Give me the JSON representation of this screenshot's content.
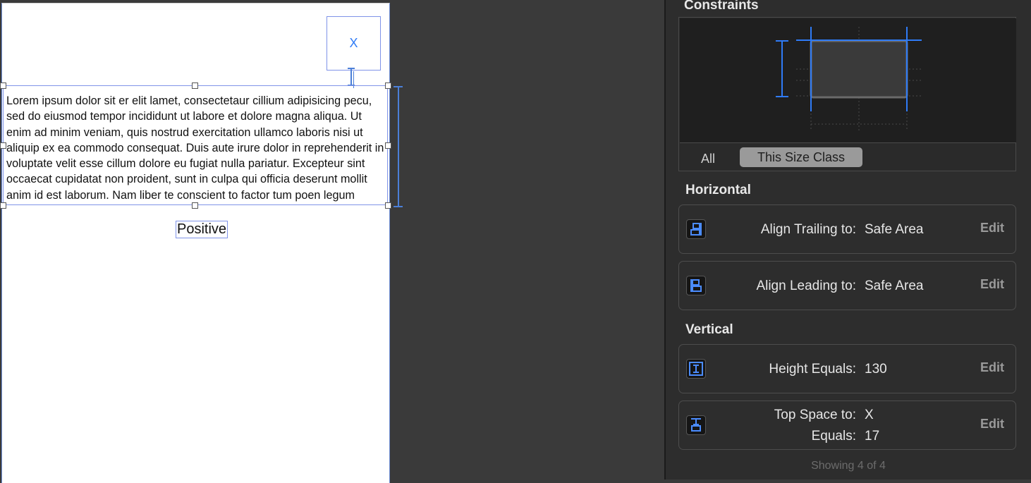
{
  "canvas": {
    "close_button_label": "X",
    "text_view_text": "Lorem ipsum dolor sit er elit lamet, consectetaur cillium adipisicing pecu, sed do eiusmod tempor incididunt ut labore et dolore magna aliqua. Ut enim ad minim veniam, quis nostrud exercitation ullamco laboris nisi ut aliquip ex ea commodo consequat. Duis aute irure dolor in reprehenderit in voluptate velit esse cillum dolore eu fugiat nulla pariatur. Excepteur sint occaecat cupidatat non proident, sunt in culpa qui officia deserunt mollit anim id est laborum. Nam liber te conscient to factor tum poen legum odioque civiuda.",
    "positive_label": "Positive"
  },
  "inspector": {
    "constraints_title": "Constraints",
    "size_class": {
      "all_label": "All",
      "this_label": "This Size Class"
    },
    "horizontal_title": "Horizontal",
    "vertical_title": "Vertical",
    "horizontal_rows": [
      {
        "label": "Align Trailing to:",
        "value": "Safe Area",
        "edit": "Edit",
        "icon": "align-trailing-icon"
      },
      {
        "label": "Align Leading to:",
        "value": "Safe Area",
        "edit": "Edit",
        "icon": "align-leading-icon"
      }
    ],
    "vertical_rows": [
      {
        "label": "Height Equals:",
        "value": "130",
        "edit": "Edit",
        "icon": "height-icon"
      },
      {
        "label": "Top Space to:",
        "value": "X",
        "label2": "Equals:",
        "value2": "17",
        "edit": "Edit",
        "icon": "top-space-icon"
      }
    ],
    "footer": "Showing 4 of 4"
  },
  "colors": {
    "accent": "#2f7bf6",
    "selection": "#7f93e8",
    "panel": "#2d2d2d",
    "canvas": "#3a3a3a"
  }
}
